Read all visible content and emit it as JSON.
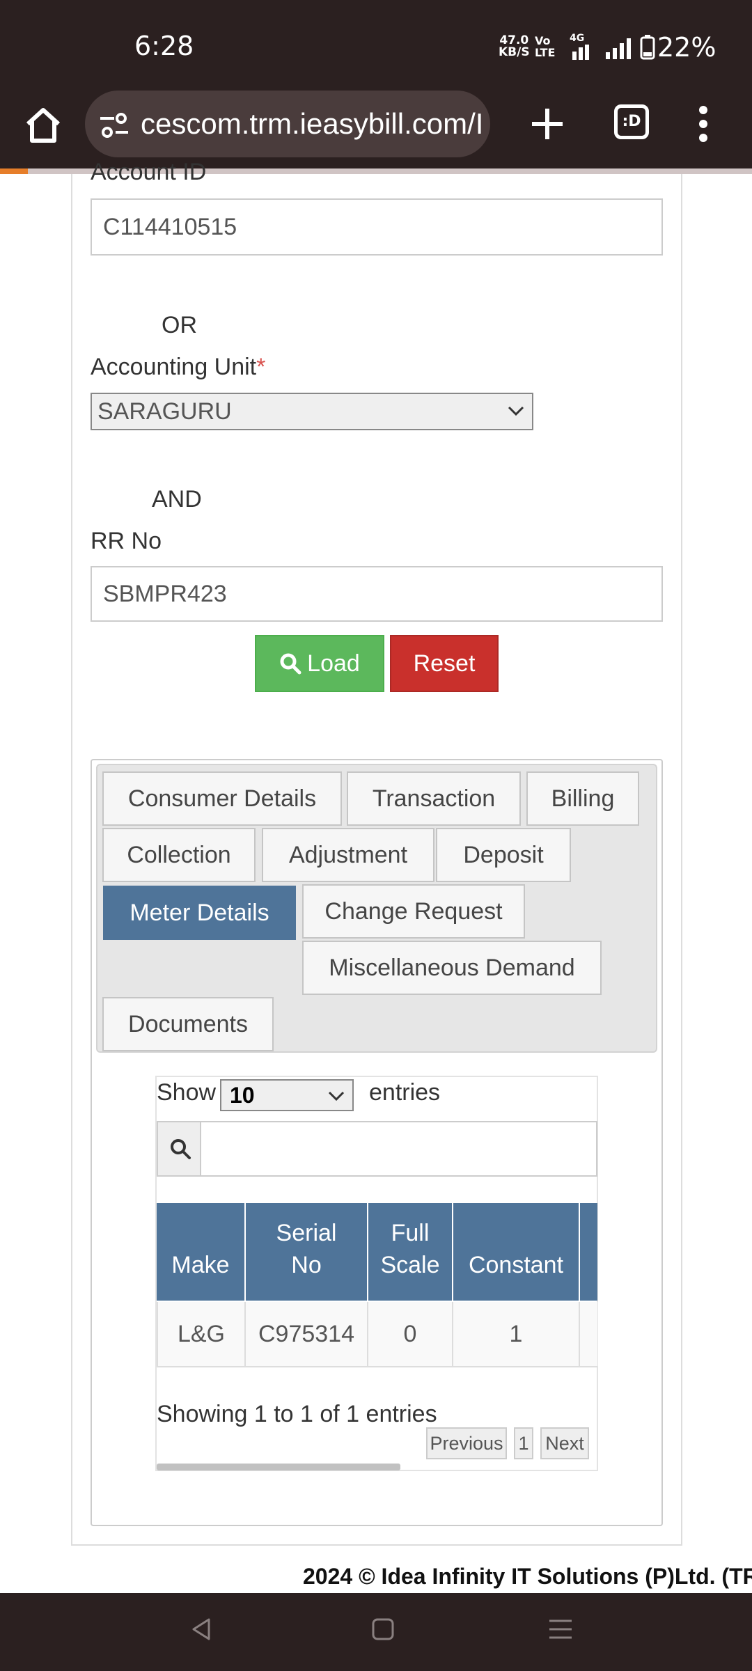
{
  "status_bar": {
    "time": "6:28",
    "net_speed_value": "47.0",
    "net_speed_unit": "KB/S",
    "volte_top": "Vo",
    "volte_bottom": "LTE",
    "network_type": "4G",
    "battery": "22%"
  },
  "browser": {
    "url": "cescom.trm.ieasybill.com/I",
    "tab_button_label": ":D"
  },
  "form": {
    "account_id_label": "Account ID",
    "account_id_value": "C114410515",
    "or_label": "OR",
    "accounting_unit_label": "Accounting Unit",
    "required_mark": "*",
    "accounting_unit_value": "SARAGURU",
    "and_label": "AND",
    "rr_no_label": "RR No",
    "rr_no_value": "SBMPR423",
    "load_label": "Load",
    "reset_label": "Reset"
  },
  "tabs": [
    {
      "label": "Consumer Details"
    },
    {
      "label": "Transaction"
    },
    {
      "label": "Billing"
    },
    {
      "label": "Collection"
    },
    {
      "label": "Adjustment"
    },
    {
      "label": "Deposit"
    },
    {
      "label": "Meter Details",
      "active": true
    },
    {
      "label": "Change Request"
    },
    {
      "label": "Miscellaneous Demand"
    },
    {
      "label": "Documents"
    }
  ],
  "table": {
    "show_label": "Show",
    "entries_value": "10",
    "entries_label": "entries",
    "search_value": "",
    "columns": [
      {
        "line1": "",
        "line2": "Make"
      },
      {
        "line1": "Serial",
        "line2": "No"
      },
      {
        "line1": "Full",
        "line2": "Scale"
      },
      {
        "line1": "",
        "line2": "Constant"
      }
    ],
    "rows": [
      [
        "L&G",
        "C975314",
        "0",
        "1"
      ]
    ],
    "info": "Showing 1 to 1 of 1 entries",
    "pagination": {
      "previous": "Previous",
      "page": "1",
      "next": "Next"
    }
  },
  "footer": "2024 © Idea Infinity IT Solutions (P)Ltd. (TR",
  "colors": {
    "status_bar_bg": "#2b2020",
    "load_button": "#5cb85c",
    "reset_button": "#c9302c",
    "active_tab": "#4f7499",
    "table_header": "#4f7499"
  }
}
